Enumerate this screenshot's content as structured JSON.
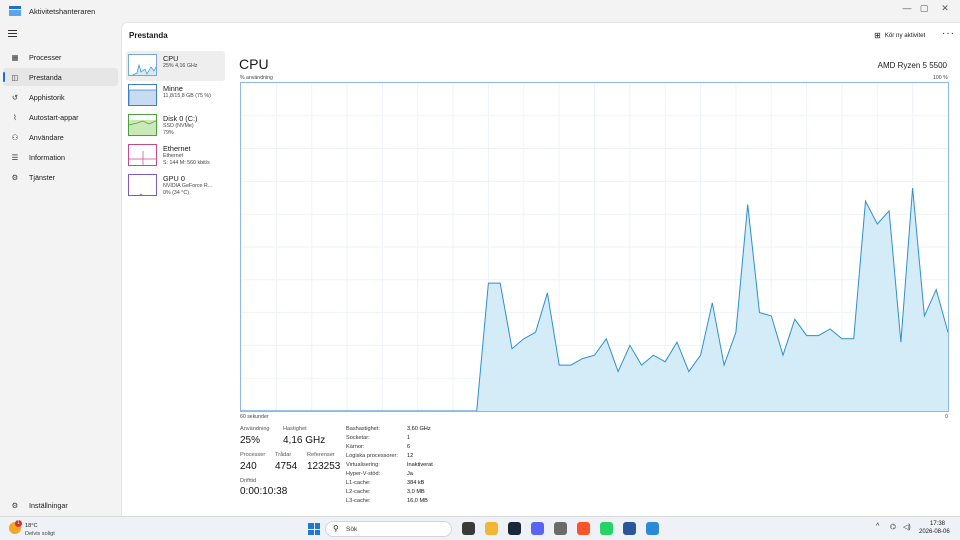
{
  "window": {
    "title": "Aktivitetshanteraren",
    "controls": {
      "minimize": "—",
      "maximize": "▢",
      "close": "✕"
    }
  },
  "sidebar": {
    "items": [
      {
        "label": "Processer",
        "icon": "grid-icon",
        "glyph": "▦"
      },
      {
        "label": "Prestanda",
        "icon": "performance-icon",
        "glyph": "◫"
      },
      {
        "label": "Apphistorik",
        "icon": "history-icon",
        "glyph": "↺"
      },
      {
        "label": "Autostart-appar",
        "icon": "startup-icon",
        "glyph": "⌇"
      },
      {
        "label": "Användare",
        "icon": "users-icon",
        "glyph": "⚇"
      },
      {
        "label": "Information",
        "icon": "details-icon",
        "glyph": "☰"
      },
      {
        "label": "Tjänster",
        "icon": "services-icon",
        "glyph": "⚙"
      }
    ],
    "settings": {
      "label": "Inställningar",
      "icon": "settings-icon",
      "glyph": "⚙"
    }
  },
  "header": {
    "title": "Prestanda",
    "run_task_label": "Kör ny aktivitet",
    "more_label": "···"
  },
  "devices": [
    {
      "name": "CPU",
      "sub1": "25% 4,16 GHz",
      "sub2": "",
      "sub3": ""
    },
    {
      "name": "Minne",
      "sub1": "11,8/15,8 GB (75 %)",
      "sub2": "",
      "sub3": ""
    },
    {
      "name": "Disk 0 (C:)",
      "sub1": "SSD (NVMe)",
      "sub2": "79%",
      "sub3": ""
    },
    {
      "name": "Ethernet",
      "sub1": "Ethernet",
      "sub2": "S: 144 M: 560 kbit/s",
      "sub3": ""
    },
    {
      "name": "GPU 0",
      "sub1": "NVIDIA GeForce R...",
      "sub2": "0% (34 °C)",
      "sub3": ""
    }
  ],
  "main": {
    "title": "CPU",
    "model": "AMD Ryzen 5 5500",
    "y_label": "% användning",
    "y_max_label": "100 %",
    "x_left_label": "60 sekunder",
    "x_right_label": "0"
  },
  "chart_data": {
    "type": "area",
    "x_range_seconds": [
      60,
      0
    ],
    "ylim": [
      0,
      100
    ],
    "grid": true,
    "x": [
      60,
      59,
      58,
      57,
      56,
      55,
      54,
      53,
      52,
      51,
      50,
      49,
      48,
      47,
      46,
      45,
      44,
      43,
      42,
      41,
      40,
      39,
      38,
      37,
      36,
      35,
      34,
      33,
      32,
      31,
      30,
      29,
      28,
      27,
      26,
      25,
      24,
      23,
      22,
      21,
      20,
      19,
      18,
      17,
      16,
      15,
      14,
      13,
      12,
      11,
      10,
      9,
      8,
      7,
      6,
      5,
      4,
      3,
      2,
      1,
      0
    ],
    "values": [
      0,
      0,
      0,
      0,
      0,
      0,
      0,
      0,
      0,
      0,
      0,
      0,
      0,
      0,
      0,
      0,
      0,
      0,
      0,
      0,
      0,
      39,
      39,
      19,
      22,
      24,
      36,
      14,
      14,
      16,
      17,
      22,
      12,
      20,
      14,
      17,
      15,
      21,
      12,
      17,
      33,
      14,
      24,
      63,
      30,
      29,
      17,
      28,
      23,
      23,
      25,
      22,
      22,
      64,
      57,
      61,
      21,
      68,
      29,
      37,
      24
    ],
    "series": [
      {
        "values_ref": "values",
        "color": "#d4ecf8",
        "stroke": "#2f8fd0"
      }
    ]
  },
  "stats": {
    "usage": {
      "label": "Användning",
      "value": "25%"
    },
    "speed": {
      "label": "Hastighet",
      "value": "4,16 GHz"
    },
    "processes": {
      "label": "Processer",
      "value": "240"
    },
    "threads": {
      "label": "Trådar",
      "value": "4754"
    },
    "handles": {
      "label": "Referenser",
      "value": "123253"
    },
    "uptime": {
      "label": "Drifttid",
      "value": "0:00:10:38"
    }
  },
  "specs": [
    {
      "label": "Bashastighet:",
      "value": "3,60 GHz"
    },
    {
      "label": "Socketar:",
      "value": "1"
    },
    {
      "label": "Kärnor:",
      "value": "6"
    },
    {
      "label": "Logiska processorer:",
      "value": "12"
    },
    {
      "label": "Virtualisering:",
      "value": "Inaktiverat"
    },
    {
      "label": "Hyper-V-stöd:",
      "value": "Ja"
    },
    {
      "label": "L1-cache:",
      "value": "384 kB"
    },
    {
      "label": "L2-cache:",
      "value": "3,0 MB"
    },
    {
      "label": "L3-cache:",
      "value": "16,0 MB"
    }
  ],
  "taskbar": {
    "weather_temp": "18°C",
    "weather_cond": "Delvis soligt",
    "weather_badge": "1",
    "search_placeholder": "Sök",
    "apps": [
      {
        "name": "taskview-icon",
        "color": "#3a3a3a"
      },
      {
        "name": "file-explorer-icon",
        "color": "#f2b636"
      },
      {
        "name": "steam-icon",
        "color": "#1b2838"
      },
      {
        "name": "discord-icon",
        "color": "#5865f2"
      },
      {
        "name": "settings-app-icon",
        "color": "#6b6b6b"
      },
      {
        "name": "brave-icon",
        "color": "#fb542b"
      },
      {
        "name": "whatsapp-icon",
        "color": "#25d366"
      },
      {
        "name": "word-icon",
        "color": "#2b579a"
      },
      {
        "name": "task-manager-icon",
        "color": "#2a8ad4"
      }
    ],
    "tray_chevron": "^",
    "time": "17:38",
    "date": "2026-08-06"
  }
}
